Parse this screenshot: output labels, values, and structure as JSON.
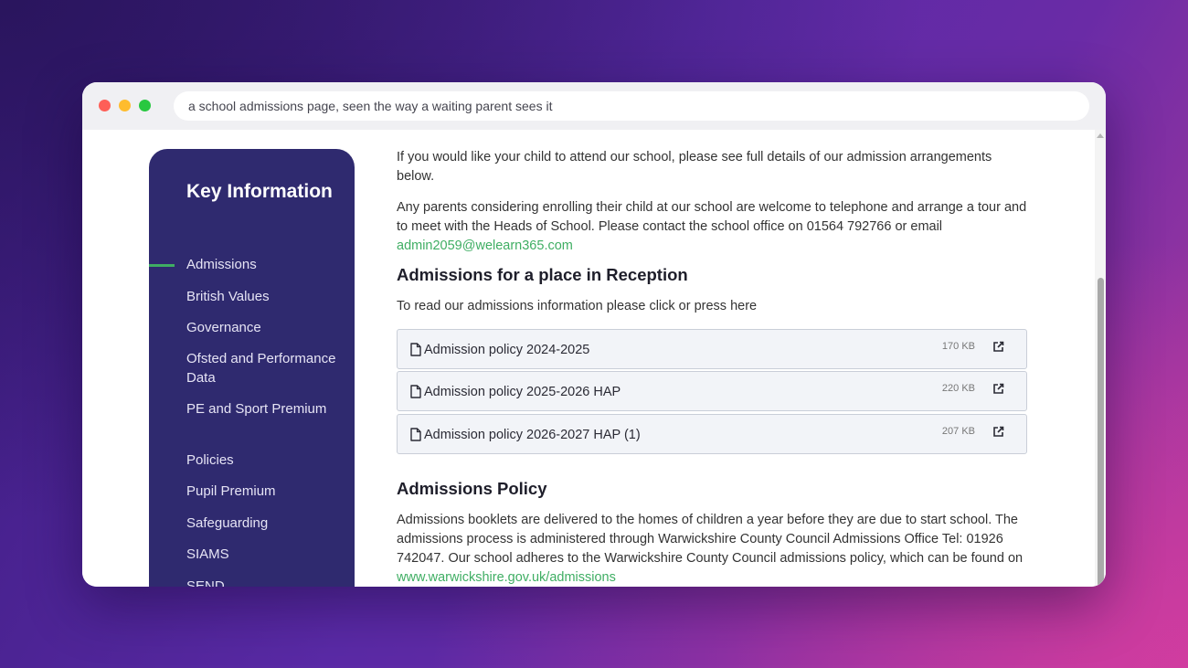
{
  "browser": {
    "address_text": "a school admissions page, seen the way a waiting parent sees it"
  },
  "sidebar": {
    "title": "Key Information",
    "items": [
      {
        "label": "Admissions",
        "active": true
      },
      {
        "label": "British Values",
        "active": false
      },
      {
        "label": "Governance",
        "active": false
      },
      {
        "label": "Ofsted and Performance Data",
        "active": false
      },
      {
        "label": "PE and Sport Premium",
        "active": false
      },
      {
        "label": "Policies",
        "active": false
      },
      {
        "label": "Pupil Premium",
        "active": false
      },
      {
        "label": "Safeguarding",
        "active": false
      },
      {
        "label": "SIAMS",
        "active": false
      },
      {
        "label": "SEND",
        "active": false
      }
    ]
  },
  "main": {
    "intro": "If you would like your child to attend our school, please see full details of our admission arrangements below.",
    "contact_text": "Any parents considering enrolling their child at our school are welcome to telephone and arrange a tour and to meet with the Heads of School. Please contact the school office on 01564 792766 or email",
    "contact_email": "admin2059@welearn365.com",
    "reception_heading": "Admissions for a place in Reception",
    "reception_text": "To read our admissions information please click or press here",
    "files": [
      {
        "name": "Admission policy 2024-2025",
        "size": "170 KB"
      },
      {
        "name": "Admission policy 2025-2026 HAP",
        "size": "220 KB"
      },
      {
        "name": "Admission policy 2026-2027 HAP (1)",
        "size": "207 KB"
      }
    ],
    "policy_heading": "Admissions Policy",
    "policy_text": "Admissions booklets are delivered to the homes of children a year before they are due to start school. The admissions process is administered through Warwickshire County Council Admissions Office Tel: 01926 742047. Our school adheres to the Warwickshire County Council admissions policy, which can be found on",
    "policy_link": "www.warwickshire.gov.uk/admissions"
  },
  "icons": {
    "file": "file-icon",
    "external_link": "external-link-icon"
  },
  "colors": {
    "sidebar_bg": "#2f2a6f",
    "accent_green": "#3fae63"
  }
}
